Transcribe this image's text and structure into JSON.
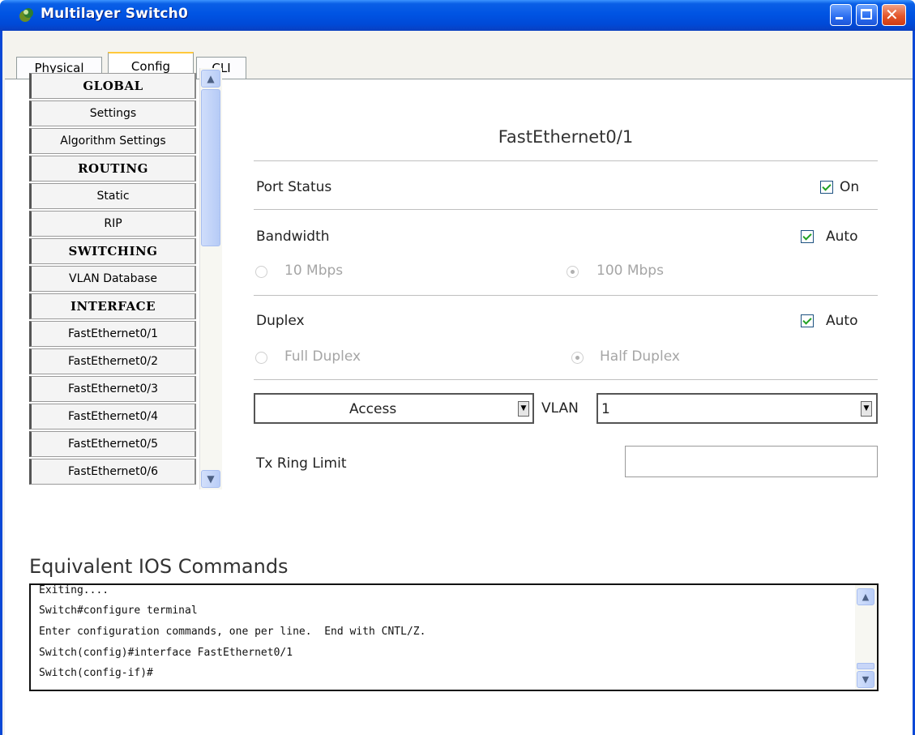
{
  "window": {
    "title": "Multilayer Switch0"
  },
  "tabs": [
    {
      "label": "Physical"
    },
    {
      "label": "Config",
      "selected": true
    },
    {
      "label": "CLI"
    }
  ],
  "sidebar": {
    "items": [
      {
        "label": "GLOBAL",
        "header": true
      },
      {
        "label": "Settings"
      },
      {
        "label": "Algorithm Settings"
      },
      {
        "label": "ROUTING",
        "header": true
      },
      {
        "label": "Static"
      },
      {
        "label": "RIP"
      },
      {
        "label": "SWITCHING",
        "header": true
      },
      {
        "label": "VLAN Database"
      },
      {
        "label": "INTERFACE",
        "header": true
      },
      {
        "label": "FastEthernet0/1"
      },
      {
        "label": "FastEthernet0/2"
      },
      {
        "label": "FastEthernet0/3"
      },
      {
        "label": "FastEthernet0/4"
      },
      {
        "label": "FastEthernet0/5"
      },
      {
        "label": "FastEthernet0/6"
      }
    ]
  },
  "interface": {
    "name": "FastEthernet0/1",
    "port_status": {
      "label": "Port Status",
      "checkbox_label": "On",
      "checked": true
    },
    "bandwidth": {
      "label": "Bandwidth",
      "checkbox_label": "Auto",
      "checked": true,
      "options": [
        "10 Mbps",
        "100 Mbps"
      ],
      "selected": "100 Mbps"
    },
    "duplex": {
      "label": "Duplex",
      "checkbox_label": "Auto",
      "checked": true,
      "options": [
        "Full Duplex",
        "Half Duplex"
      ],
      "selected": "Half Duplex"
    },
    "mode": {
      "value": "Access"
    },
    "vlan": {
      "label": "VLAN",
      "value": "1"
    },
    "tx_ring_limit": {
      "label": "Tx Ring Limit",
      "value": ""
    }
  },
  "ios": {
    "heading": "Equivalent IOS Commands",
    "lines": [
      "Exiting....",
      "Switch#configure terminal",
      "Enter configuration commands, one per line.  End with CNTL/Z.",
      "Switch(config)#interface FastEthernet0/1",
      "Switch(config-if)#"
    ]
  },
  "colors": {
    "titlebar": "#0054e3",
    "tab_highlight": "#ffc83c",
    "checkmark": "#21a121"
  }
}
